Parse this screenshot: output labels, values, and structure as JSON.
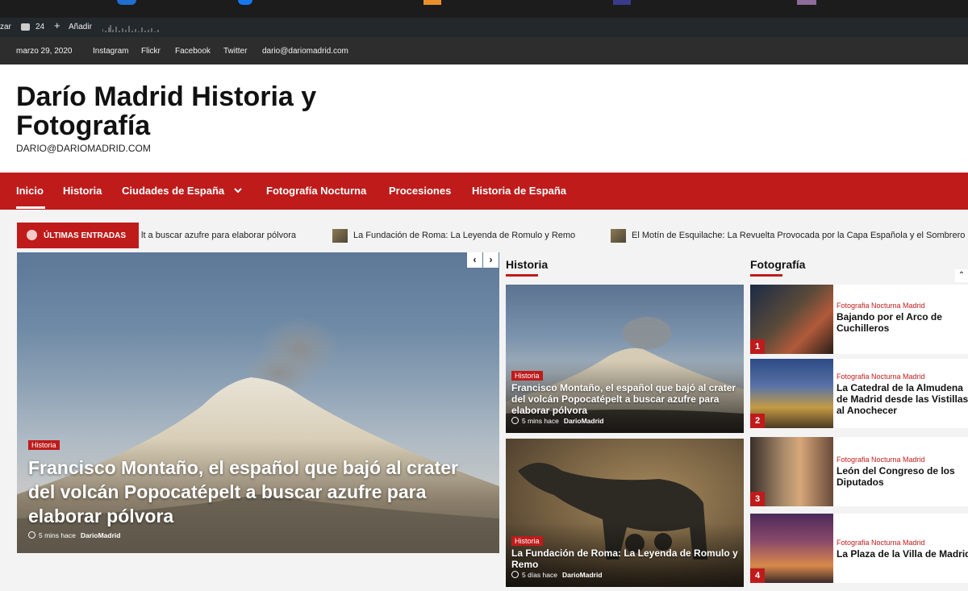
{
  "admin_bar": {
    "left_text": "zar",
    "comments_count": "24",
    "add_label": "Añadir"
  },
  "top_bar": {
    "date": "marzo 29, 2020",
    "links": [
      "Instagram",
      "Flickr",
      "Facebook",
      "Twitter",
      "dario@dariomadrid.com"
    ]
  },
  "site": {
    "title": "Darío Madrid Historia y Fotografía",
    "tagline": "DARIO@DARIOMADRID.COM"
  },
  "nav": {
    "items": [
      "Inicio",
      "Historia",
      "Ciudades de España",
      "Fotografía Nocturna",
      "Procesiones",
      "Historia de España"
    ]
  },
  "ticker": {
    "label": "ÚLTIMAS ENTRADAS",
    "items": [
      "lt a buscar azufre para elaborar pólvora",
      "La Fundación de Roma: La Leyenda de Romulo y Remo",
      "El Motín de Esquilache: La Revuelta Provocada por la Capa Española y el Sombrero"
    ]
  },
  "main_post": {
    "category": "Historia",
    "title": "Francisco Montaño, el español que bajó al crater del volcán Popocatépelt a buscar azufre para elaborar pólvora",
    "time": "5 mins hace",
    "author": "DarioMadrid"
  },
  "slider_nav": {
    "prev": "‹",
    "next": "›"
  },
  "historia": {
    "heading": "Historia",
    "posts": [
      {
        "category": "Historia",
        "title": "Francisco Montaño, el español que bajó al crater del volcán Popocatépelt a buscar azufre para elaborar pólvora",
        "time": "5 mins hace",
        "author": "DarioMadrid"
      },
      {
        "category": "Historia",
        "title": "La Fundación de Roma: La Leyenda de Romulo y Remo",
        "time": "5 días hace",
        "author": "DarioMadrid"
      }
    ]
  },
  "fotografia": {
    "heading": "Fotografía",
    "items": [
      {
        "num": "1",
        "category": "Fotografia Nocturna Madrid",
        "title": "Bajando por el Arco de Cuchilleros"
      },
      {
        "num": "2",
        "category": "Fotografia Nocturna Madrid",
        "title": "La Catedral de la Almudena de Madrid desde las Vistillas al Anochecer"
      },
      {
        "num": "3",
        "category": "Fotografia Nocturna Madrid",
        "title": "León del Congreso de los Diputados"
      },
      {
        "num": "4",
        "category": "Fotografia Nocturna Madrid",
        "title": "La Plaza de la Villa de Madrid"
      }
    ]
  },
  "colors": {
    "accent": "#bf1b1b",
    "dark_bar": "#2d2d2d",
    "admin_bar": "#23282d"
  }
}
